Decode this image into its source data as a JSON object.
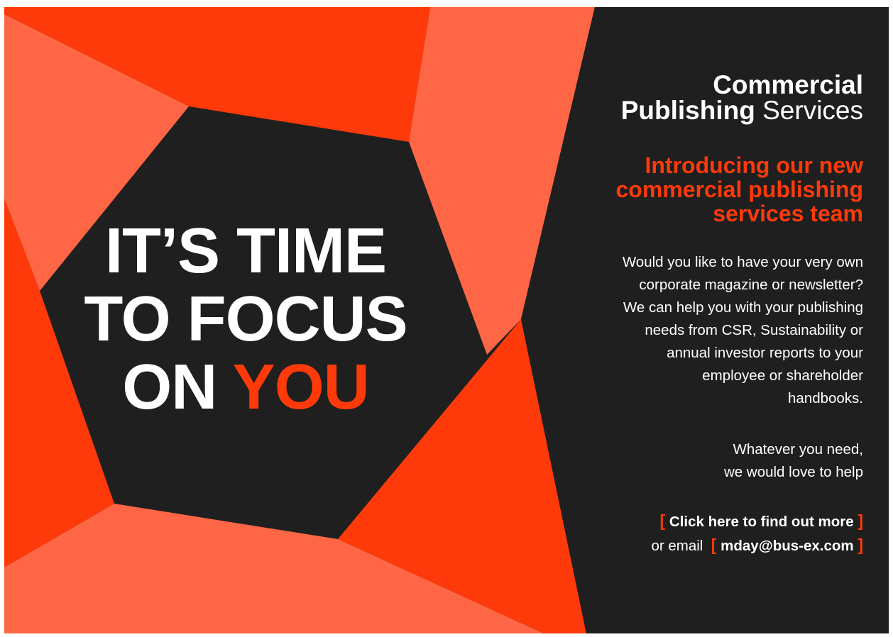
{
  "headline": {
    "line1": "IT’S TIME",
    "line2": "TO FOCUS",
    "line3_prefix": "ON ",
    "line3_accent": "YOU"
  },
  "brand": {
    "line1": "Commercial",
    "line2_bold": "Publishing",
    "line2_light": " Services"
  },
  "intro": {
    "line1": "Introducing our new",
    "line2": "commercial publishing",
    "line3": "services team"
  },
  "body_lines": [
    "Would you like to have your very own",
    "corporate magazine or newsletter?",
    "We can help you with your publishing",
    "needs from CSR, Sustainability or",
    "annual investor reports to your",
    "employee or shareholder",
    "handbooks."
  ],
  "help": {
    "line1": "Whatever you need,",
    "line2": "we would love to help"
  },
  "cta": {
    "open_bracket": "[",
    "close_bracket": "]",
    "find_out_more": "Click here to find out more",
    "or_email": "or email",
    "email": "mday@bus-ex.com"
  },
  "colors": {
    "accent": "#ff3a0a",
    "accent_light": "#ff6645",
    "dark": "#1f1f1f",
    "text": "#ffffff"
  }
}
